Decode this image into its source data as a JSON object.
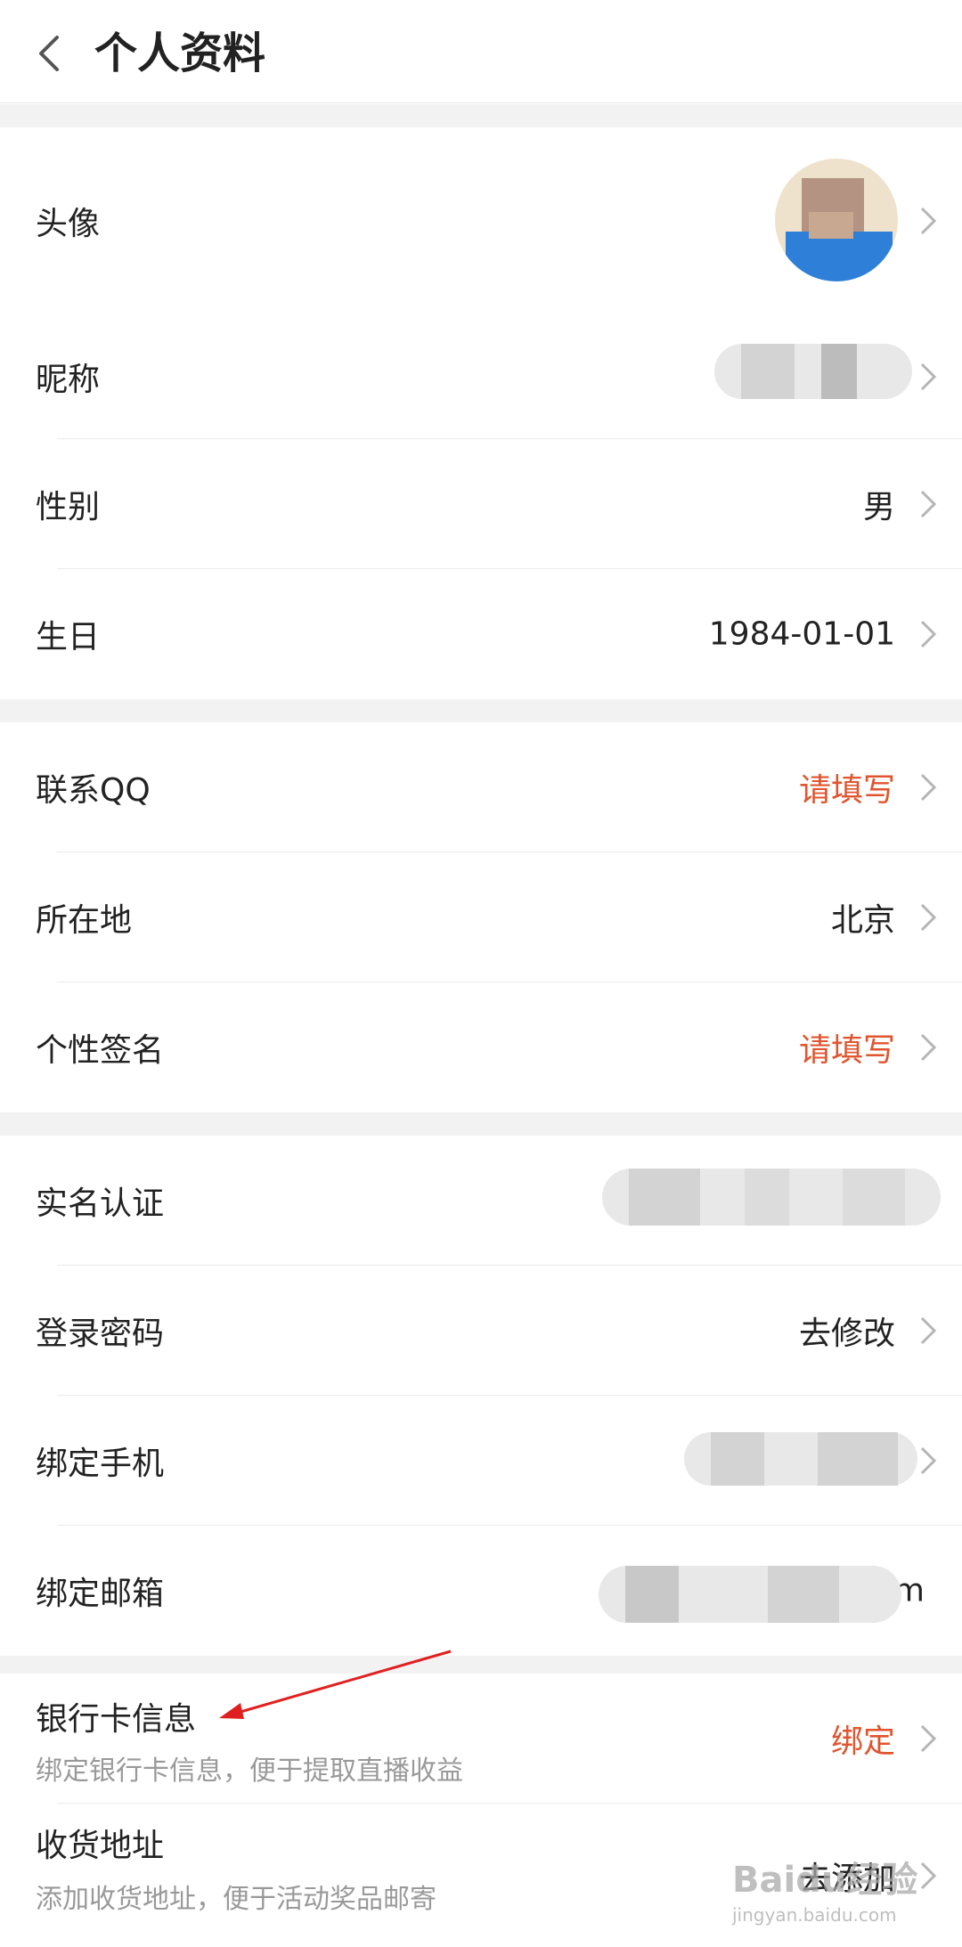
{
  "header": {
    "title": "个人资料"
  },
  "section1": {
    "avatar_label": "头像",
    "nickname_label": "昵称",
    "gender_label": "性别",
    "gender_value": "男",
    "birthday_label": "生日",
    "birthday_value": "1984-01-01"
  },
  "section2": {
    "qq_label": "联系QQ",
    "qq_value": "请填写",
    "location_label": "所在地",
    "location_value": "北京",
    "signature_label": "个性签名",
    "signature_value": "请填写"
  },
  "section3": {
    "realname_label": "实名认证",
    "password_label": "登录密码",
    "password_value": "去修改",
    "phone_label": "绑定手机",
    "email_label": "绑定邮箱",
    "email_value_tail": "m"
  },
  "section4": {
    "bank_label": "银行卡信息",
    "bank_sub": "绑定银行卡信息，便于提取直播收益",
    "bank_value": "绑定",
    "address_label": "收货地址",
    "address_sub": "添加收货地址，便于活动奖品邮寄",
    "address_value": "去添加"
  },
  "watermark": {
    "main": "Baidu经验",
    "sub": "jingyan.baidu.com"
  },
  "colors": {
    "accent_red": "#e0552f",
    "bg_gap": "#f2f2f2",
    "sub_text": "#999999"
  }
}
